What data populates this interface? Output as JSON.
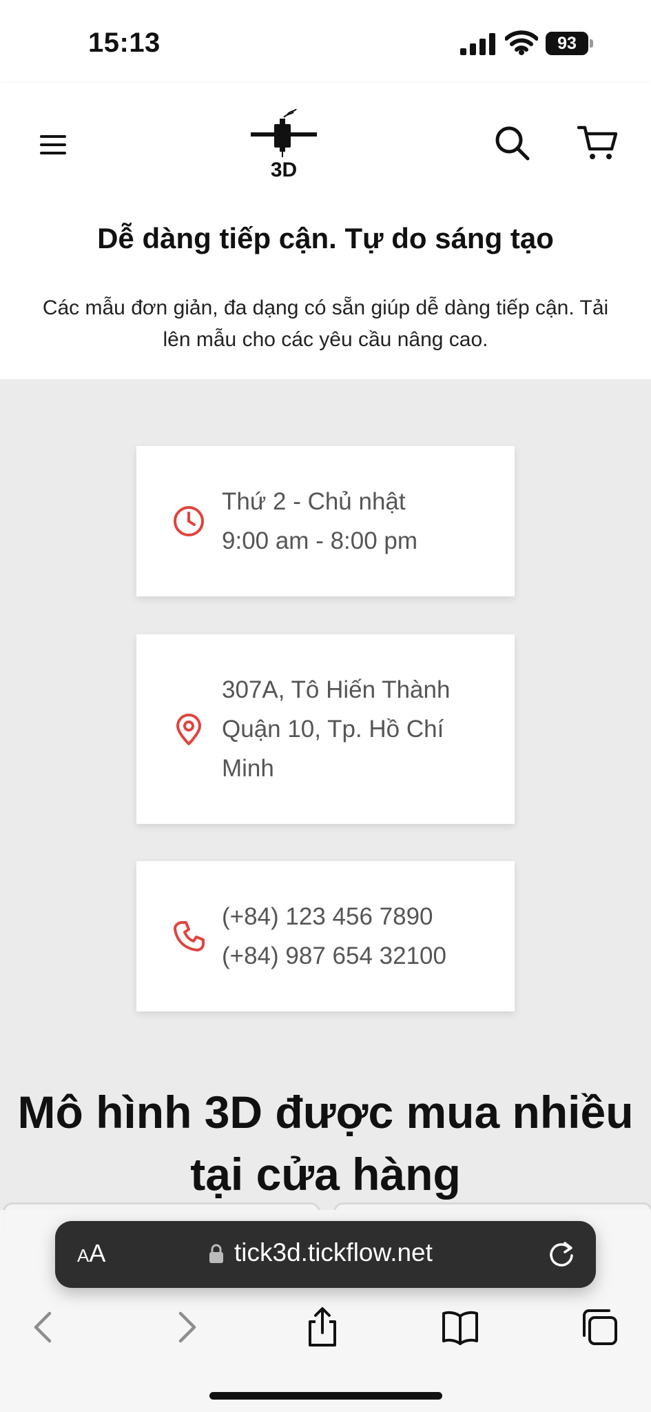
{
  "status_bar": {
    "time": "15:13",
    "battery": "93"
  },
  "header": {
    "menu_icon": "hamburger-menu-icon",
    "logo_icon": "3d-printer-logo",
    "logo_text": "3D",
    "search_icon": "search-icon",
    "cart_icon": "shopping-cart-icon"
  },
  "intro": {
    "title": "Dễ dàng tiếp cận. Tự do sáng tạo",
    "description": "Các mẫu đơn giản, đa dạng có sẵn giúp dễ dàng tiếp cận. Tải lên mẫu cho các yêu cầu nâng cao."
  },
  "info_cards": [
    {
      "icon": "clock-icon",
      "lines": [
        "Thứ 2 - Chủ nhật",
        "9:00 am - 8:00 pm"
      ]
    },
    {
      "icon": "map-pin-icon",
      "lines": [
        "307A, Tô Hiến Thành",
        "Quận 10, Tp. Hồ Chí",
        "Minh"
      ]
    },
    {
      "icon": "phone-icon",
      "lines": [
        "(+84) 123 456 7890",
        "(+84) 987 654 32100"
      ]
    }
  ],
  "section": {
    "title": "Mô hình 3D được mua nhiều tại cửa hàng"
  },
  "browser": {
    "aa_small": "A",
    "aa_large": "A",
    "url": "tick3d.tickflow.net",
    "toolbar": [
      "back-icon",
      "forward-icon",
      "share-icon",
      "bookmarks-icon",
      "tabs-icon"
    ]
  },
  "colors": {
    "accent": "#e0443e",
    "card_text": "#555555",
    "page_bg": "#ebebeb"
  }
}
